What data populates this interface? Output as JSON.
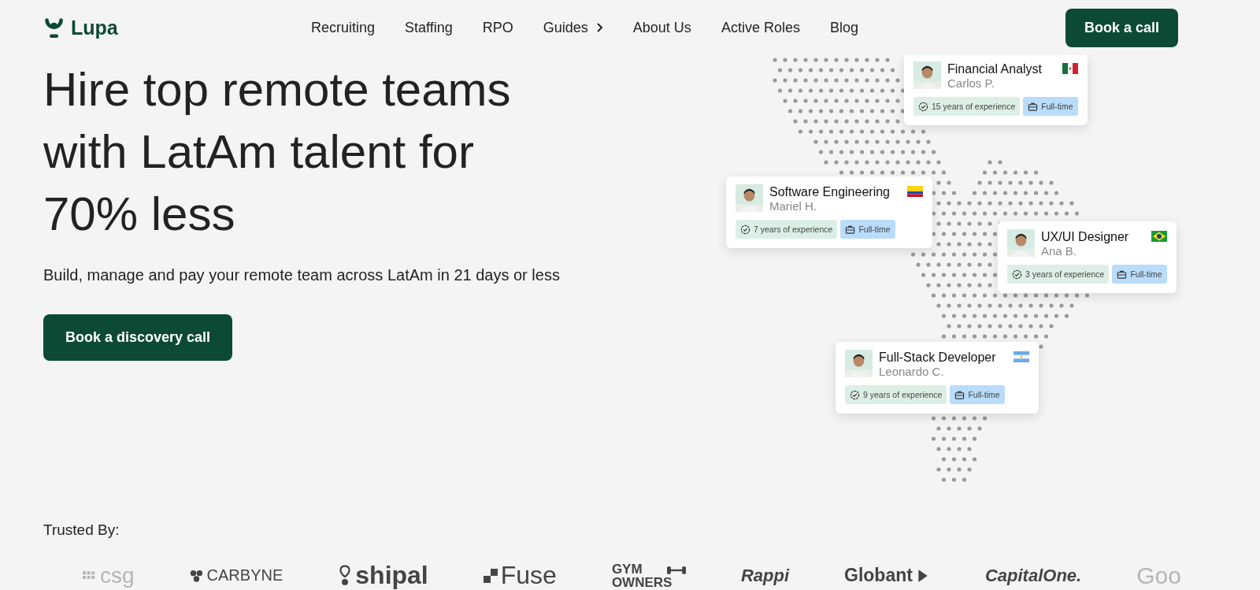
{
  "header": {
    "logo": "Lupa",
    "nav": [
      {
        "label": "Recruiting",
        "has_arrow": false
      },
      {
        "label": "Staffing",
        "has_arrow": false
      },
      {
        "label": "RPO",
        "has_arrow": false
      },
      {
        "label": "Guides",
        "has_arrow": true
      },
      {
        "label": "About Us",
        "has_arrow": false
      },
      {
        "label": "Active Roles",
        "has_arrow": false
      },
      {
        "label": "Blog",
        "has_arrow": false
      }
    ],
    "cta": "Book a call"
  },
  "hero": {
    "heading": "Hire top remote teams with LatAm talent for 70% less",
    "subtitle": "Build, manage and pay your remote team across LatAm in 21 days or less",
    "button": "Book a discovery call"
  },
  "talent_cards": [
    {
      "title": "Financial Analyst",
      "name": "Carlos P.",
      "kind": "mexico",
      "experience": "15 years of experience",
      "type": "Full-time"
    },
    {
      "title": "Software Engineering",
      "name": "Mariel H.",
      "kind": "colombia",
      "experience": "7 years of experience",
      "type": "Full-time"
    },
    {
      "title": "UX/UI Designer",
      "name": "Ana B.",
      "kind": "brazil",
      "experience": "3 years of experience",
      "type": "Full-time"
    },
    {
      "title": "Full-Stack Developer",
      "name": "Leonardo C.",
      "kind": "argentina",
      "experience": "9 years of experience",
      "type": "Full-time"
    }
  ],
  "trusted": {
    "label": "Trusted By:",
    "logos": [
      {
        "text": "csg",
        "kind": "grid",
        "faded": true
      },
      {
        "text": "CARBYNE",
        "kind": "dots",
        "faded": false
      },
      {
        "text": "shipal",
        "kind": "balloon",
        "faded": false
      },
      {
        "text": "Fuse",
        "kind": "squares",
        "faded": false
      },
      {
        "text": "GYM OWNERS",
        "kind": "dumbbell",
        "faded": false
      },
      {
        "text": "Rappi",
        "kind": "script",
        "faded": false
      },
      {
        "text": "Globant",
        "kind": "chevron",
        "faded": false
      },
      {
        "text": "**Capital**One.",
        "kind": "script",
        "faded": false
      },
      {
        "text": "Goo",
        "kind": "plain",
        "faded": true
      }
    ]
  }
}
